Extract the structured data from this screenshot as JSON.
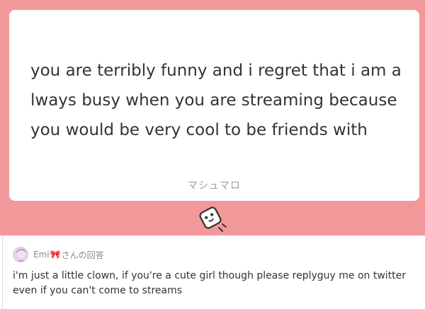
{
  "question": {
    "text": "you are terribly funny and i regret that i am always busy when you are streaming because you would be very cool to be friends with",
    "brand": "マシュマロ"
  },
  "mascot": {
    "icon": "marshmallow-mascot-icon"
  },
  "answer": {
    "avatar_icon": "avatar-icon",
    "answerer_name_prefix": "Emi",
    "answerer_bow_icon": "ribbon-bow-icon",
    "answerer_suffix": "さんの回答",
    "text": "i'm just a little clown, if you're a cute girl though please replyguy me on twitter even if you can't come to streams"
  },
  "colors": {
    "background_pink": "#f2989b",
    "card": "#ffffff",
    "text": "#333333",
    "muted": "#8a8a8a"
  }
}
